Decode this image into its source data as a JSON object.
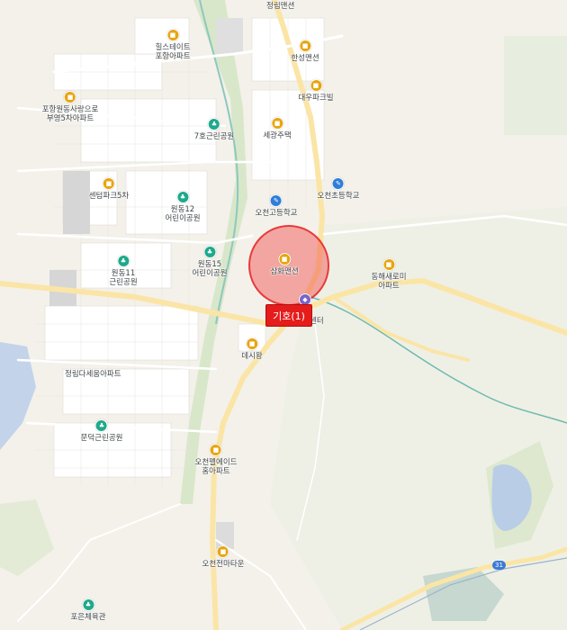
{
  "map": {
    "pois": [
      {
        "id": "top-label",
        "type": "none",
        "label": "정림맨션"
      },
      {
        "id": "hillstate",
        "type": "apt",
        "label": "힐스테이트\n포항아파트"
      },
      {
        "id": "hanseong",
        "type": "apt",
        "label": "한성맨션"
      },
      {
        "id": "daewoo",
        "type": "apt",
        "label": "대우파크빌"
      },
      {
        "id": "bugyeong",
        "type": "apt",
        "label": "포항원동사랑으로\n부영5차아파트"
      },
      {
        "id": "park7",
        "type": "park",
        "label": "7호근린공원"
      },
      {
        "id": "segwang",
        "type": "apt",
        "label": "세광주택"
      },
      {
        "id": "centerpark",
        "type": "apt",
        "label": "센텀파크5차"
      },
      {
        "id": "wondong12",
        "type": "park",
        "label": "원동12\n어린이공원"
      },
      {
        "id": "ocheon-elem",
        "type": "school",
        "label": "오천초등학교"
      },
      {
        "id": "ocheon-high",
        "type": "school",
        "label": "오천고등학교"
      },
      {
        "id": "wondong15",
        "type": "park",
        "label": "원동15\n어린이공원"
      },
      {
        "id": "wondong11",
        "type": "park",
        "label": "원동11\n근린공원"
      },
      {
        "id": "samhwa",
        "type": "apt",
        "label": "삼화맨션"
      },
      {
        "id": "donghae",
        "type": "apt",
        "label": "동해새로미\n아파트"
      },
      {
        "id": "center",
        "type": "church",
        "label": "센터"
      },
      {
        "id": "daesiwang",
        "type": "apt",
        "label": "데시왕"
      },
      {
        "id": "jeongrim",
        "type": "none",
        "label": "정림다세움아파트"
      },
      {
        "id": "mundeok",
        "type": "park",
        "label": "문덕근린공원"
      },
      {
        "id": "ocheon-fell",
        "type": "apt",
        "label": "오천펠에이드\n홈아파트"
      },
      {
        "id": "ocheon-town",
        "type": "apt",
        "label": "오천전마타운"
      },
      {
        "id": "poeun",
        "type": "park",
        "label": "포은체육관"
      }
    ],
    "marker": {
      "label": "기호(1)"
    },
    "road_shield": "31",
    "colors": {
      "radius_fill": "#f03c3c",
      "marker": "#e51c1c",
      "apt_icon": "#e8a50f",
      "park_icon": "#1fa98c",
      "school_icon": "#2f7fd8",
      "water": "#b9cde6",
      "river": "#6fb9b0"
    }
  }
}
